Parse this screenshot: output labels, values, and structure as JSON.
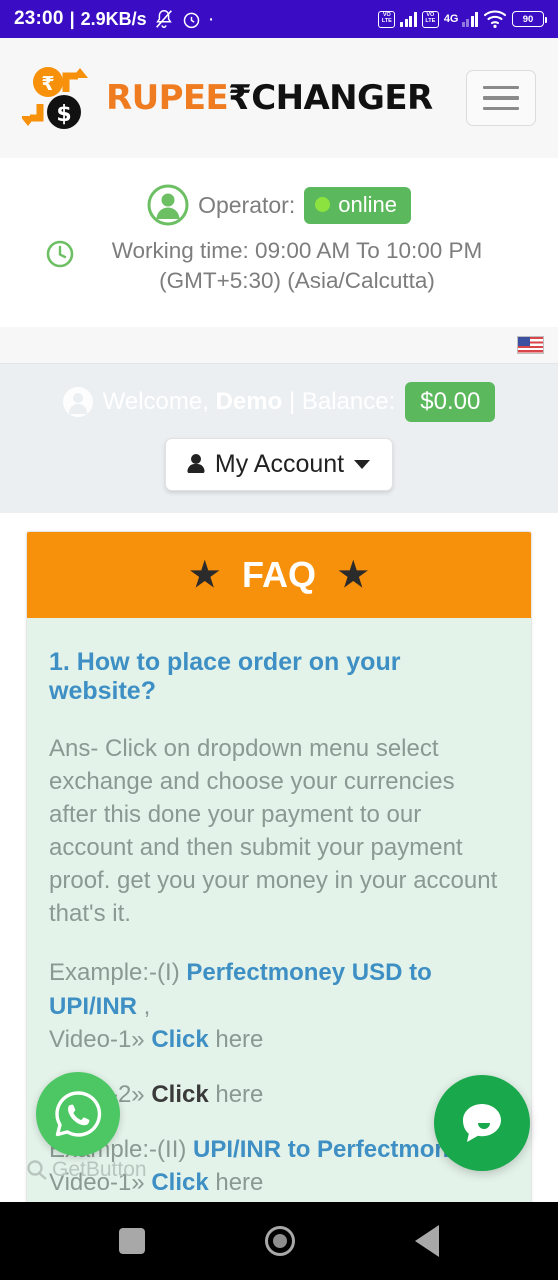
{
  "statusbar": {
    "clock": "23:00",
    "separator": "|",
    "speed": "2.9KB/s",
    "volte_line1": "VO",
    "volte_line2": "LTE",
    "network": "4G",
    "battery": "90"
  },
  "header": {
    "logo_rupee": "RUPEE",
    "logo_symbol": "₹",
    "logo_changer": "CHANGER",
    "menu_label": "Menu"
  },
  "operator": {
    "label": "Operator:",
    "status": "online",
    "working_time": "Working time: 09:00 AM To 10:00 PM (GMT+5:30) (Asia/Calcutta)"
  },
  "welcome": {
    "greeting": "Welcome,",
    "username": "Demo",
    "divider": "|",
    "balance_label": "Balance:",
    "balance_value": "$0.00",
    "account_button": "My Account"
  },
  "faq": {
    "title": "FAQ",
    "star": "★",
    "question": "1. How to place order on your website?",
    "answer": "Ans- Click on dropdown menu select exchange and choose your currencies after this done your payment to our account and then submit your payment proof. get you your money in your account that's it.",
    "examples": [
      {
        "prefix": "Example:-(I) ",
        "pair": "Perfectmoney USD to UPI/INR",
        "suffix": " ,",
        "video_label": "Video-1»",
        "link": "Click",
        "link_tail": " here"
      },
      {
        "video_label": "Video-2»",
        "link": "Click",
        "link_tail": " here"
      },
      {
        "prefix": "Example:-(II) ",
        "pair": "UPI/INR to Perfectmoney",
        "video_label": "Video-1»",
        "link": "Click",
        "link_tail": " here"
      }
    ]
  },
  "floating": {
    "whatsapp": "whatsapp-button",
    "chat": "chat-button",
    "watermark": "GetButton"
  },
  "colors": {
    "statusbar": "#3a0cc4",
    "accent_orange": "#f7900a",
    "logo_orange": "#ef7c20",
    "green": "#5cb85c",
    "faq_body": "#e4f3ea",
    "link_blue": "#3d8fc4",
    "whatsapp_green": "#4cc764",
    "chat_green": "#1aa84c"
  }
}
